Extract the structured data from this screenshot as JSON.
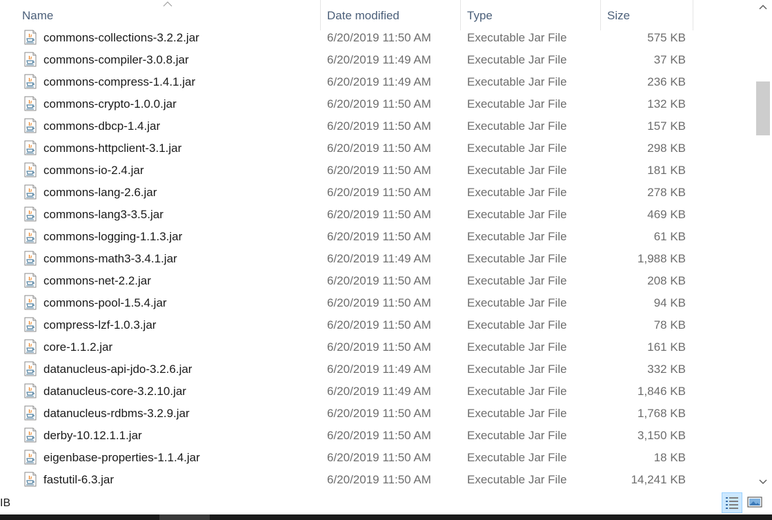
{
  "columns": {
    "name": "Name",
    "date": "Date modified",
    "type": "Type",
    "size": "Size"
  },
  "files": [
    {
      "name": "commons-collections-3.2.2.jar",
      "date": "6/20/2019 11:50 AM",
      "type": "Executable Jar File",
      "size": "575 KB"
    },
    {
      "name": "commons-compiler-3.0.8.jar",
      "date": "6/20/2019 11:49 AM",
      "type": "Executable Jar File",
      "size": "37 KB"
    },
    {
      "name": "commons-compress-1.4.1.jar",
      "date": "6/20/2019 11:49 AM",
      "type": "Executable Jar File",
      "size": "236 KB"
    },
    {
      "name": "commons-crypto-1.0.0.jar",
      "date": "6/20/2019 11:50 AM",
      "type": "Executable Jar File",
      "size": "132 KB"
    },
    {
      "name": "commons-dbcp-1.4.jar",
      "date": "6/20/2019 11:50 AM",
      "type": "Executable Jar File",
      "size": "157 KB"
    },
    {
      "name": "commons-httpclient-3.1.jar",
      "date": "6/20/2019 11:50 AM",
      "type": "Executable Jar File",
      "size": "298 KB"
    },
    {
      "name": "commons-io-2.4.jar",
      "date": "6/20/2019 11:50 AM",
      "type": "Executable Jar File",
      "size": "181 KB"
    },
    {
      "name": "commons-lang-2.6.jar",
      "date": "6/20/2019 11:50 AM",
      "type": "Executable Jar File",
      "size": "278 KB"
    },
    {
      "name": "commons-lang3-3.5.jar",
      "date": "6/20/2019 11:50 AM",
      "type": "Executable Jar File",
      "size": "469 KB"
    },
    {
      "name": "commons-logging-1.1.3.jar",
      "date": "6/20/2019 11:50 AM",
      "type": "Executable Jar File",
      "size": "61 KB"
    },
    {
      "name": "commons-math3-3.4.1.jar",
      "date": "6/20/2019 11:49 AM",
      "type": "Executable Jar File",
      "size": "1,988 KB"
    },
    {
      "name": "commons-net-2.2.jar",
      "date": "6/20/2019 11:50 AM",
      "type": "Executable Jar File",
      "size": "208 KB"
    },
    {
      "name": "commons-pool-1.5.4.jar",
      "date": "6/20/2019 11:50 AM",
      "type": "Executable Jar File",
      "size": "94 KB"
    },
    {
      "name": "compress-lzf-1.0.3.jar",
      "date": "6/20/2019 11:50 AM",
      "type": "Executable Jar File",
      "size": "78 KB"
    },
    {
      "name": "core-1.1.2.jar",
      "date": "6/20/2019 11:50 AM",
      "type": "Executable Jar File",
      "size": "161 KB"
    },
    {
      "name": "datanucleus-api-jdo-3.2.6.jar",
      "date": "6/20/2019 11:49 AM",
      "type": "Executable Jar File",
      "size": "332 KB"
    },
    {
      "name": "datanucleus-core-3.2.10.jar",
      "date": "6/20/2019 11:49 AM",
      "type": "Executable Jar File",
      "size": "1,846 KB"
    },
    {
      "name": "datanucleus-rdbms-3.2.9.jar",
      "date": "6/20/2019 11:50 AM",
      "type": "Executable Jar File",
      "size": "1,768 KB"
    },
    {
      "name": "derby-10.12.1.1.jar",
      "date": "6/20/2019 11:50 AM",
      "type": "Executable Jar File",
      "size": "3,150 KB"
    },
    {
      "name": "eigenbase-properties-1.1.4.jar",
      "date": "6/20/2019 11:50 AM",
      "type": "Executable Jar File",
      "size": "18 KB"
    },
    {
      "name": "fastutil-6.3.jar",
      "date": "6/20/2019 11:50 AM",
      "type": "Executable Jar File",
      "size": "14,241 KB"
    }
  ],
  "status": {
    "text": "IB"
  },
  "icons": {
    "file": "java-jar-icon",
    "sort": "sort-ascending-icon",
    "details_view": "details-view-icon",
    "tiles_view": "large-icons-view-icon"
  },
  "colors": {
    "header_text": "#4c607a",
    "selected_view": "#cce8ff",
    "scroll_thumb": "#cdcdcd"
  }
}
